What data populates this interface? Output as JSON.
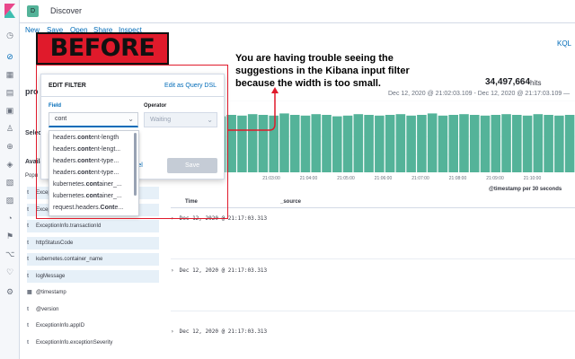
{
  "header": {
    "space_initial": "D",
    "title": "Discover"
  },
  "menu": {
    "new": "New",
    "save": "Save",
    "open": "Open",
    "share": "Share",
    "inspect": "Inspect"
  },
  "query_language": "KQL",
  "add_filter": "+ Add filter",
  "sidebar": {
    "index_pattern": "pro",
    "selected_label": "Select",
    "available_label": "Availa",
    "popular_label": "Popu",
    "fields": [
      {
        "type": "t",
        "name": "ExceptionInfo.exceptionMessage"
      },
      {
        "type": "t",
        "name": "ExceptionInfo.httpStatusCode"
      },
      {
        "type": "t",
        "name": "ExceptionInfo.transactionId"
      },
      {
        "type": "t",
        "name": "httpStatusCode"
      },
      {
        "type": "t",
        "name": "kubernetes.container_name"
      },
      {
        "type": "t",
        "name": "logMessage"
      },
      {
        "type": "cal",
        "name": "@timestamp"
      },
      {
        "type": "t",
        "name": "@version"
      },
      {
        "type": "t",
        "name": "ExceptionInfo.appID"
      },
      {
        "type": "t",
        "name": "ExceptionInfo.exceptionSeverity"
      }
    ]
  },
  "hits": {
    "count": "34,497,664",
    "label": "hits"
  },
  "date_range": "Dec 12, 2020 @ 21:02:03.109 - Dec 12, 2020 @ 21:17:03.109 —",
  "chart_data": {
    "type": "bar",
    "x_ticks": [
      "21:03:00",
      "21:04:00",
      "21:05:00",
      "21:06:00",
      "21:07:00",
      "21:08:00",
      "21:09:00",
      "21:10:00"
    ],
    "values": [
      78,
      80,
      79,
      81,
      80,
      79,
      82,
      80,
      79,
      81,
      80,
      78,
      79,
      81,
      80,
      79,
      80,
      81,
      79,
      80,
      82,
      79,
      80,
      81,
      80,
      79,
      80,
      81,
      80,
      79,
      81,
      80,
      79,
      80
    ],
    "xlabel": "@timestamp per 30 seconds",
    "color": "#54b399",
    "grid": true
  },
  "table": {
    "col_time": "Time",
    "col_source": "_source",
    "rows": [
      "Dec 12, 2020 @ 21:17:03.313",
      "Dec 12, 2020 @ 21:17:03.313",
      "Dec 12, 2020 @ 21:17:03.313"
    ]
  },
  "filter_popover": {
    "title": "EDIT FILTER",
    "dsl_link": "Edit as Query DSL",
    "field_label": "Field",
    "operator_label": "Operator",
    "field_value": "cont",
    "operator_placeholder": "Waiting",
    "cancel": "ncel",
    "save": "Save",
    "suggestions": [
      {
        "pre": "headers.",
        "match": "cont",
        "post": "ent-length"
      },
      {
        "pre": "headers.",
        "match": "cont",
        "post": "ent-lengt..."
      },
      {
        "pre": "headers.",
        "match": "cont",
        "post": "ent-type..."
      },
      {
        "pre": "headers.",
        "match": "cont",
        "post": "ent-type..."
      },
      {
        "pre": "kubernetes.",
        "match": "cont",
        "post": "ainer_..."
      },
      {
        "pre": "kubernetes.",
        "match": "cont",
        "post": "ainer_..."
      },
      {
        "pre": "request.headers.",
        "match": "Cont",
        "post": "e..."
      }
    ]
  },
  "annotation": {
    "label": "BEFORE",
    "text": "You are having trouble seeing the suggestions in the Kibana input filter because the width is too small.",
    "color": "#e01a2b"
  }
}
